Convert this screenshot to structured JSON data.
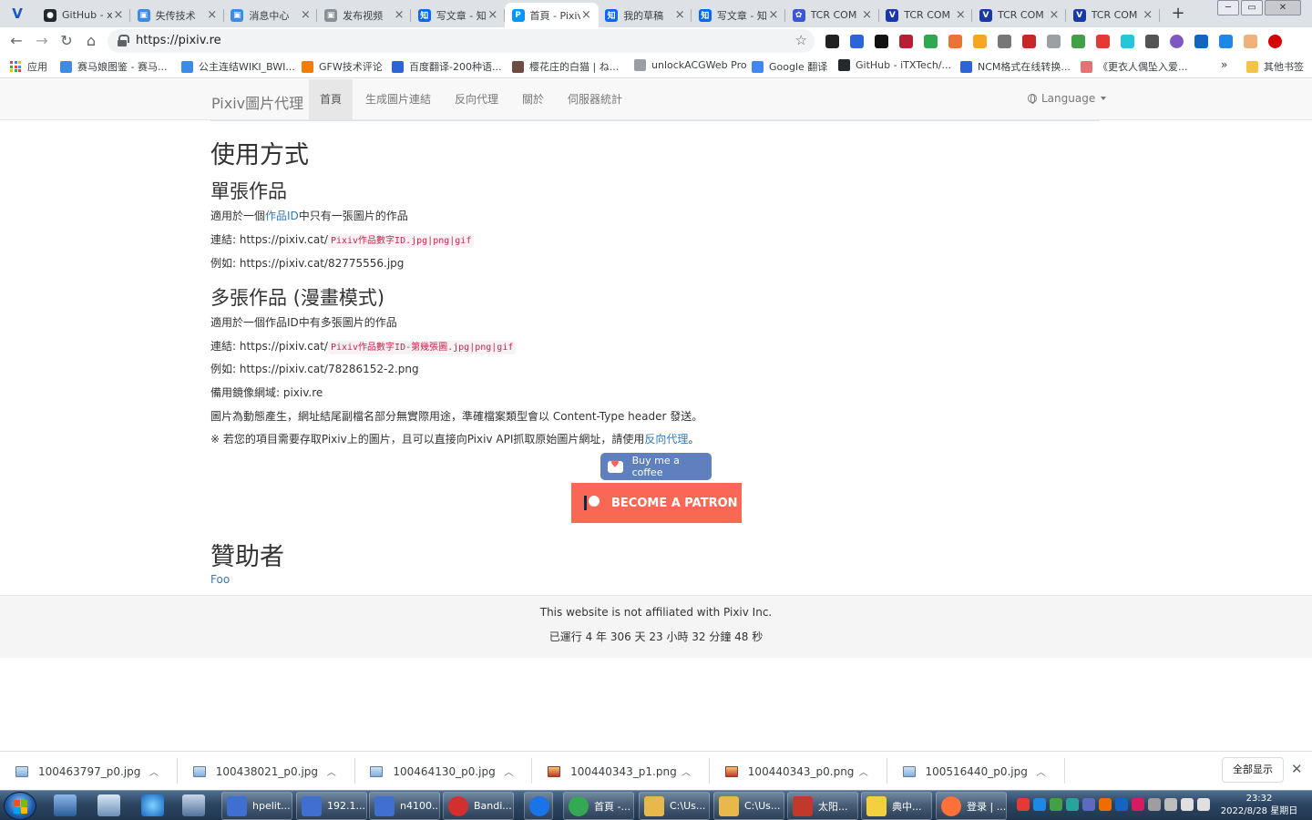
{
  "browser": {
    "tabs": [
      {
        "title": "GitHub - x",
        "color": "#24292e",
        "glyph": "●"
      },
      {
        "title": "失传技术",
        "color": "#3c8ce7",
        "glyph": "▣"
      },
      {
        "title": "消息中心",
        "color": "#3c8ce7",
        "glyph": "▣"
      },
      {
        "title": "发布视频",
        "color": "#8a8f96",
        "glyph": "▣"
      },
      {
        "title": "写文章 - 知",
        "color": "#0a66ff",
        "glyph": "知"
      },
      {
        "title": "首頁 - Pixiv",
        "color": "#0096fa",
        "glyph": "P",
        "active": true
      },
      {
        "title": "我的草稿",
        "color": "#0a66ff",
        "glyph": "知"
      },
      {
        "title": "写文章 - 知",
        "color": "#0a66ff",
        "glyph": "知"
      },
      {
        "title": "TCR COM",
        "color": "#3b57d9",
        "glyph": "✿"
      },
      {
        "title": "TCR COM",
        "color": "#1838a8",
        "glyph": "V"
      },
      {
        "title": "TCR COM",
        "color": "#1838a8",
        "glyph": "V"
      },
      {
        "title": "TCR COM",
        "color": "#1838a8",
        "glyph": "V"
      }
    ],
    "address": "https://pixiv.re",
    "bookmarks": [
      {
        "label": "应用",
        "color": "#e94235"
      },
      {
        "label": "赛马娘图鉴 - 赛马...",
        "color": "#3c8ce7"
      },
      {
        "label": "公主连结WIKI_BWI...",
        "color": "#3c8ce7"
      },
      {
        "label": "GFW技术评论",
        "color": "#f57c00"
      },
      {
        "label": "百度翻译-200种语...",
        "color": "#2d64d8"
      },
      {
        "label": "樱花庄的白猫 | ね...",
        "color": "#6d4c41"
      },
      {
        "label": "unlockACGWeb Pro",
        "color": "#9aa0a6"
      },
      {
        "label": "Google 翻译",
        "color": "#4285f4"
      },
      {
        "label": "GitHub - iTXTech/...",
        "color": "#24292e"
      },
      {
        "label": "NCM格式在线转换...",
        "color": "#2d64d8"
      },
      {
        "label": "《更衣人偶坠入爱...",
        "color": "#e57373"
      },
      {
        "label": "其他书签",
        "color": "#f4c542"
      }
    ],
    "bookmarks_more": "»"
  },
  "site": {
    "brand": "Pixiv圖片代理",
    "nav": [
      "首頁",
      "生成圖片連結",
      "反向代理",
      "關於",
      "伺服器統計"
    ],
    "language": "Language",
    "usage_title": "使用方式",
    "single": {
      "title": "單張作品",
      "desc_before": "適用於一個",
      "desc_link": "作品ID",
      "desc_after": "中只有一張圖片的作品",
      "link_label": "連結: https://pixiv.cat/",
      "link_code": "Pixiv作品數字ID.jpg|png|gif",
      "example": "例如: https://pixiv.cat/82775556.jpg"
    },
    "multi": {
      "title": "多張作品 (漫畫模式)",
      "desc": "適用於一個作品ID中有多張圖片的作品",
      "link_label": "連結: https://pixiv.cat/",
      "link_code": "Pixiv作品數字ID-第幾張圖.jpg|png|gif",
      "example": "例如: https://pixiv.cat/78286152-2.png",
      "mirror": "備用鏡像網域: pixiv.re",
      "note": "圖片為動態產生，網址結尾副檔名部分無實際用途，準確檔案類型會以 Content-Type header 發送。",
      "warn_before": "※ 若您的項目需要存取Pixiv上的圖片，且可以直接向Pixiv API抓取原始圖片網址，請使用",
      "warn_link": "反向代理",
      "warn_after": "。"
    },
    "buy_coffee": "Buy me a coffee",
    "patron": "BECOME A PATRON",
    "sponsors_title": "贊助者",
    "sponsor": "Foo",
    "footer_note": "This website is not affiliated with Pixiv Inc.",
    "uptime": "已運行 4 年 306 天 23 小時 32 分鐘 48 秒"
  },
  "downloads": {
    "items": [
      {
        "name": "100463797_p0.jpg",
        "type": "jpg"
      },
      {
        "name": "100438021_p0.jpg",
        "type": "jpg"
      },
      {
        "name": "100464130_p0.jpg",
        "type": "jpg"
      },
      {
        "name": "100440343_p1.png",
        "type": "png"
      },
      {
        "name": "100440343_p0.png",
        "type": "png"
      },
      {
        "name": "100516440_p0.jpg",
        "type": "jpg"
      }
    ],
    "show_all": "全部显示"
  },
  "taskbar": {
    "buttons": [
      {
        "label": "hpelit...",
        "color": "#3f6fd1"
      },
      {
        "label": "192.1...",
        "color": "#3f6fd1"
      },
      {
        "label": "n4100...",
        "color": "#3f6fd1"
      },
      {
        "label": "Bandi...",
        "color": "#d32f2f"
      },
      {
        "label": "",
        "color": "#1a73e8"
      },
      {
        "label": "首頁 -...",
        "color": "#34a853"
      },
      {
        "label": "C:\\Us...",
        "color": "#e8b84a"
      },
      {
        "label": "C:\\Us...",
        "color": "#e8b84a"
      },
      {
        "label": "太阳...",
        "color": "#c0392b"
      },
      {
        "label": "典中...",
        "color": "#f4d03f"
      },
      {
        "label": "登录 | ...",
        "color": "#ff7139"
      }
    ],
    "time": "23:32",
    "date": "2022/8/28 星期日"
  }
}
